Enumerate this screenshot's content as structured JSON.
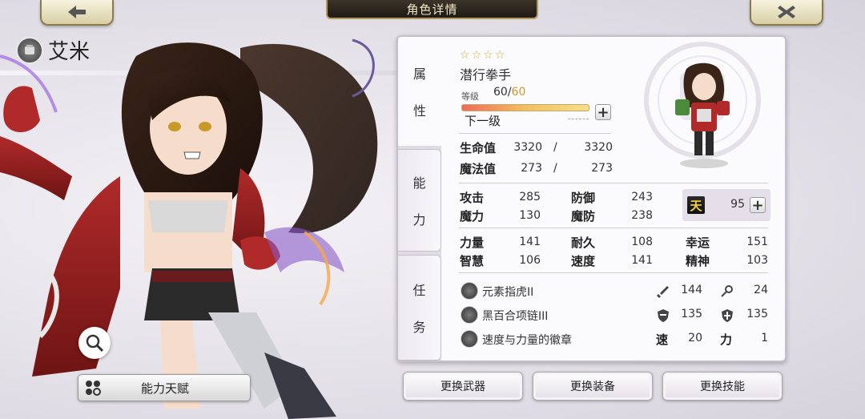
{
  "screen_title": "角色详情",
  "character": {
    "name": "艾米"
  },
  "talent_button": "能力天赋",
  "tabs": [
    {
      "label_1": "属",
      "label_2": "性"
    },
    {
      "label_1": "能",
      "label_2": "力"
    },
    {
      "label_1": "任",
      "label_2": "务"
    }
  ],
  "profile": {
    "stars": [
      "☆",
      "☆",
      "☆",
      "☆"
    ],
    "class": "潜行拳手",
    "level_label": "等级",
    "level": "60",
    "level_sep": "/",
    "level_max": "60",
    "next_level": "下一级"
  },
  "vitals": {
    "hp_label": "生命值",
    "hp_current": "3320",
    "hp_max": "3320",
    "mp_label": "魔法值",
    "mp_current": "273",
    "mp_max": "273",
    "slash": "/"
  },
  "combat": {
    "atk_label": "攻击",
    "atk": "285",
    "def_label": "防御",
    "def": "243",
    "mag_label": "魔力",
    "mag": "130",
    "mdef_label": "魔防",
    "mdef": "238",
    "sky_glyph": "天",
    "sky_value": "95"
  },
  "attributes": {
    "str_label": "力量",
    "str": "141",
    "end_label": "耐久",
    "end": "108",
    "luck_label": "幸运",
    "luck": "151",
    "int_label": "智慧",
    "int": "106",
    "spd_label": "速度",
    "spd": "141",
    "spirit_label": "精神",
    "spirit": "103"
  },
  "equipment": [
    {
      "name": "元素指虎II",
      "stat1_icon": "sword-icon",
      "stat1": "144",
      "stat2_icon": "key-icon",
      "stat2": "24"
    },
    {
      "name": "黑百合项链III",
      "stat1_icon": "shield-icon",
      "stat1": "135",
      "stat2_icon": "cross-shield-icon",
      "stat2": "135"
    },
    {
      "name": "速度与力量的徽章",
      "stat1_label": "速",
      "stat1": "20",
      "stat2_label": "力",
      "stat2": "1"
    }
  ],
  "buttons": {
    "weapon": "更换武器",
    "gear": "更换装备",
    "skill": "更换技能"
  }
}
